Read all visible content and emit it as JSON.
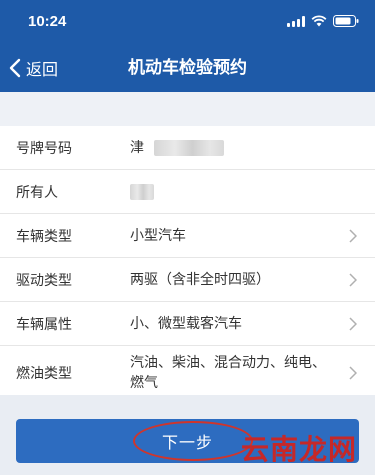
{
  "status": {
    "time": "10:24"
  },
  "nav": {
    "back_label": "返回",
    "title": "机动车检验预约"
  },
  "rows": [
    {
      "label": "号牌号码",
      "value": "津"
    },
    {
      "label": "所有人",
      "value": ""
    },
    {
      "label": "车辆类型",
      "value": "小型汽车"
    },
    {
      "label": "驱动类型",
      "value": "两驱（含非全时四驱）"
    },
    {
      "label": "车辆属性",
      "value": "小、微型载客汽车"
    },
    {
      "label": "燃油类型",
      "value": "汽油、柴油、混合动力、纯电、燃气"
    }
  ],
  "footer": {
    "next_label": "下一步"
  },
  "watermark": "云南龙网",
  "colors": {
    "primary": "#1e5aa8",
    "button": "#2d6cc0",
    "annotation": "#d0352b"
  }
}
